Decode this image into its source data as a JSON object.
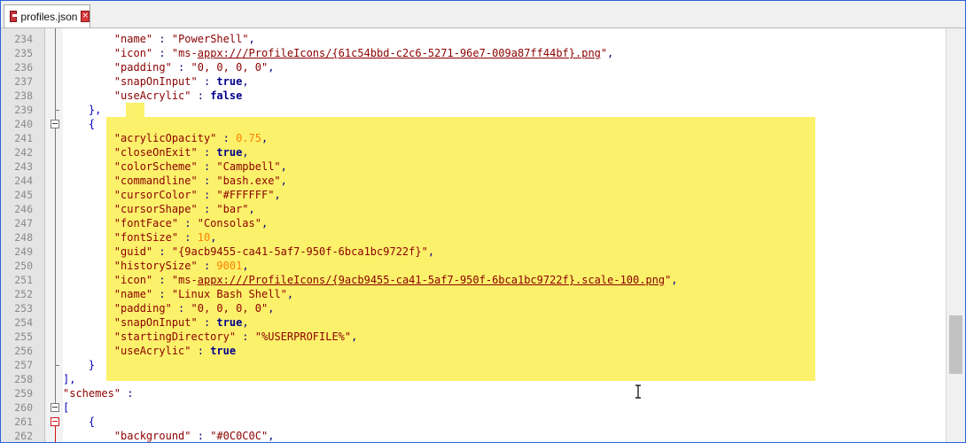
{
  "tab": {
    "title": "profiles.json"
  },
  "highlight_color": "#fcf16b",
  "lines": [
    {
      "n": "234",
      "html": "        <span class='k'>\"name\"</span> : <span class='v'>\"PowerShell\"</span>,"
    },
    {
      "n": "235",
      "html": "        <span class='k'>\"icon\"</span> : <span class='v'>\"ms-<span class='u'>appx:///ProfileIcons/{61c54bbd-c2c6-5271-96e7-009a87ff44bf}.png</span>\"</span>,"
    },
    {
      "n": "236",
      "html": "        <span class='k'>\"padding\"</span> : <span class='v'>\"0, 0, 0, 0\"</span>,"
    },
    {
      "n": "237",
      "html": "        <span class='k'>\"snapOnInput\"</span> : <span class='kw'>true</span>,"
    },
    {
      "n": "238",
      "html": "        <span class='k'>\"useAcrylic\"</span> : <span class='kw'>false</span>"
    },
    {
      "n": "239",
      "html": "    <span class='p'>},</span>"
    },
    {
      "n": "240",
      "html": "    <span class='p'>{</span>"
    },
    {
      "n": "241",
      "html": "        <span class='k'>\"acrylicOpacity\"</span> : <span class='num'>0.75</span>,"
    },
    {
      "n": "242",
      "html": "        <span class='k'>\"closeOnExit\"</span> : <span class='kw'>true</span>,"
    },
    {
      "n": "243",
      "html": "        <span class='k'>\"colorScheme\"</span> : <span class='v'>\"Campbell\"</span>,"
    },
    {
      "n": "244",
      "html": "        <span class='k'>\"commandline\"</span> : <span class='v'>\"bash.exe\"</span>,"
    },
    {
      "n": "245",
      "html": "        <span class='k'>\"cursorColor\"</span> : <span class='v'>\"#FFFFFF\"</span>,"
    },
    {
      "n": "246",
      "html": "        <span class='k'>\"cursorShape\"</span> : <span class='v'>\"bar\"</span>,"
    },
    {
      "n": "247",
      "html": "        <span class='k'>\"fontFace\"</span> : <span class='v'>\"Consolas\"</span>,"
    },
    {
      "n": "248",
      "html": "        <span class='k'>\"fontSize\"</span> : <span class='num'>10</span>,"
    },
    {
      "n": "249",
      "html": "        <span class='k'>\"guid\"</span> : <span class='v'>\"{9acb9455-ca41-5af7-950f-6bca1bc9722f}\"</span>,"
    },
    {
      "n": "250",
      "html": "        <span class='k'>\"historySize\"</span> : <span class='num'>9001</span>,"
    },
    {
      "n": "251",
      "html": "        <span class='k'>\"icon\"</span> : <span class='v'>\"ms-<span class='u'>appx:///ProfileIcons/{9acb9455-ca41-5af7-950f-6bca1bc9722f}.scale-100.png</span>\"</span>,"
    },
    {
      "n": "252",
      "html": "        <span class='k'>\"name\"</span> : <span class='v'>\"Linux Bash Shell\"</span>,"
    },
    {
      "n": "253",
      "html": "        <span class='k'>\"padding\"</span> : <span class='v'>\"0, 0, 0, 0\"</span>,"
    },
    {
      "n": "254",
      "html": "        <span class='k'>\"snapOnInput\"</span> : <span class='kw'>true</span>,"
    },
    {
      "n": "255",
      "html": "        <span class='k'>\"startingDirectory\"</span> : <span class='v'>\"%USERPROFILE%\"</span>,"
    },
    {
      "n": "256",
      "html": "        <span class='k'>\"useAcrylic\"</span> : <span class='kw'>true</span>"
    },
    {
      "n": "257",
      "html": "    <span class='p'>}</span>"
    },
    {
      "n": "258",
      "html": "<span class='p'>],</span>"
    },
    {
      "n": "259",
      "html": "<span class='k'>\"schemes\"</span> :"
    },
    {
      "n": "260",
      "html": "<span class='p'>[</span>"
    },
    {
      "n": "261",
      "html": "    <span class='p'>{</span>"
    },
    {
      "n": "262",
      "html": "        <span class='k'>\"background\"</span> : <span class='v'>\"#0C0C0C\"</span>,"
    }
  ]
}
